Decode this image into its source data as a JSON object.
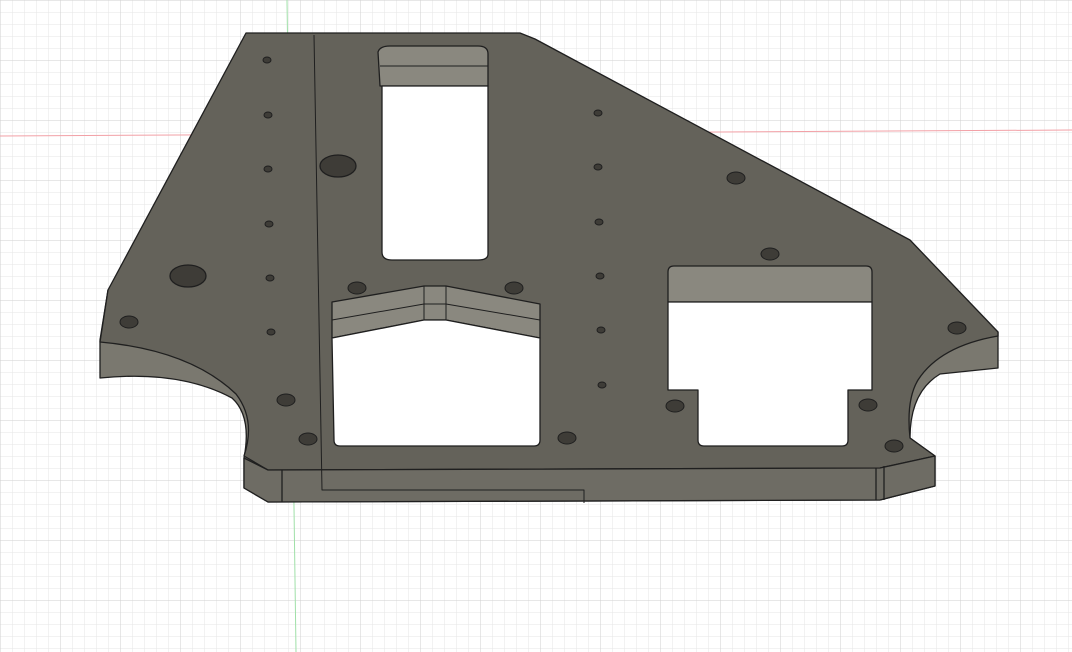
{
  "viewport": {
    "background_color": "#ffffff",
    "grid_minor_color": "#e6e6e6",
    "grid_major_color": "#cfcfcf",
    "axis_x_color": "#f2a0a6",
    "axis_y_color": "#9fe0a8"
  },
  "model": {
    "face_color": "#64625a",
    "side_color": "#7a786f",
    "edge_color": "#1f1f1f",
    "wall_color": "#8a887f",
    "hole_color": "#3e3c37"
  }
}
